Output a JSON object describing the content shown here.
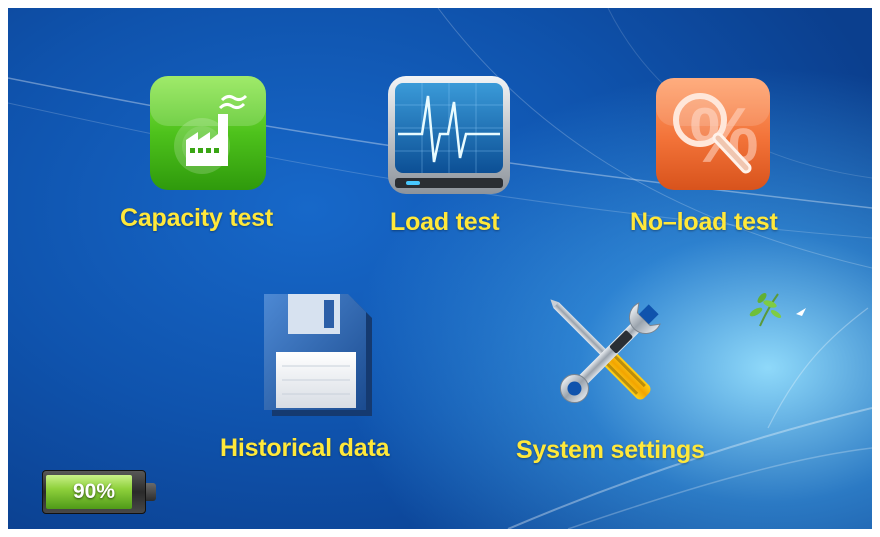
{
  "apps": {
    "capacity_test": {
      "label": "Capacity test",
      "icon": "factory-icon"
    },
    "load_test": {
      "label": "Load test",
      "icon": "heartbeat-monitor-icon"
    },
    "no_load_test": {
      "label": "No–load test",
      "icon": "magnifier-percent-icon"
    },
    "historical_data": {
      "label": "Historical data",
      "icon": "floppy-disk-icon"
    },
    "system_settings": {
      "label": "System settings",
      "icon": "wrench-screwdriver-icon"
    }
  },
  "battery": {
    "level_text": "90%",
    "level_fraction": 0.9
  },
  "colors": {
    "label": "#ffe83a",
    "background": "#1060c0",
    "battery_fill": "#8fd13c"
  }
}
